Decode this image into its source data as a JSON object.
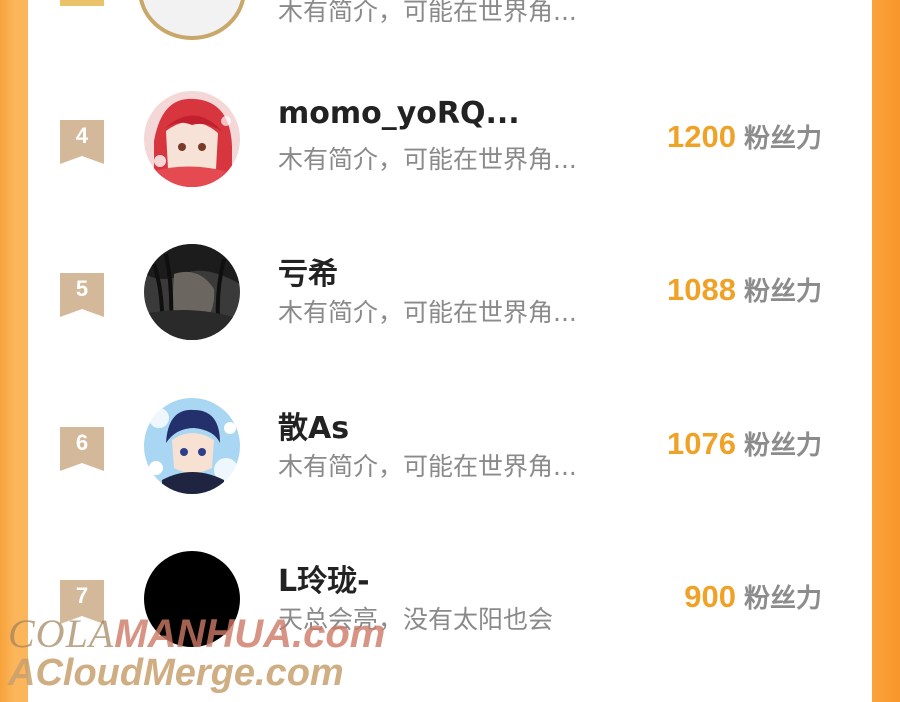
{
  "top_partial": {
    "bio": "木有简介，可能在世界角..."
  },
  "fans_unit": "粉丝力",
  "rows": [
    {
      "rank": "4",
      "username": "momo_yoRQ...",
      "bio": "木有简介，可能在世界角...",
      "fans": "1200"
    },
    {
      "rank": "5",
      "username": "亏希",
      "bio": "木有简介，可能在世界角...",
      "fans": "1088"
    },
    {
      "rank": "6",
      "username": "散As",
      "bio": "木有简介，可能在世界角...",
      "fans": "1076"
    },
    {
      "rank": "7",
      "username": "L玲珑-",
      "bio": "天总会亮，没有太阳也会",
      "fans": "900"
    }
  ],
  "watermarks": {
    "line1_a": "COLA",
    "line1_b": "MANHUA",
    "line1_c": ".com",
    "line2": "ACloudMerge.com"
  },
  "colors": {
    "accent": "#f0a227",
    "badge": "#d4b89a",
    "border": "#fba33c"
  }
}
